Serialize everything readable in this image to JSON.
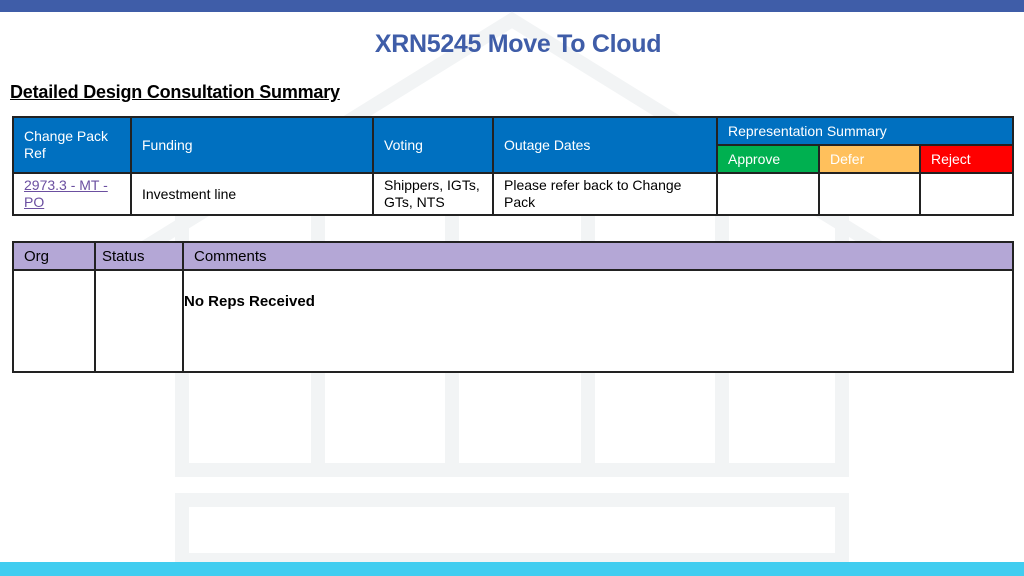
{
  "header": {
    "title": "XRN5245 Move To Cloud"
  },
  "section": {
    "subtitle": "Detailed Design Consultation Summary"
  },
  "summary_table": {
    "columns": [
      "Change Pack Ref",
      "Funding",
      "Voting",
      "Outage Dates",
      "Representation Summary"
    ],
    "representation_subcolumns": [
      "Approve",
      "Defer",
      "Reject"
    ],
    "representation_colors": {
      "approve": "#00b050",
      "defer": "#ffc05c",
      "reject": "#ff0000"
    },
    "rows": [
      {
        "change_pack_ref": "2973.3 - MT - PO",
        "funding": "Investment line",
        "voting": "Shippers, IGTs, GTs, NTS",
        "outage_dates": "Please refer back to Change Pack",
        "approve": "",
        "defer": "",
        "reject": ""
      }
    ]
  },
  "reps_table": {
    "columns": [
      "Org",
      "Status",
      "Comments"
    ],
    "rows": [
      {
        "org": "",
        "status": "",
        "comments": "No Reps Received"
      }
    ]
  },
  "colors": {
    "title": "#3f5da8",
    "header_blue": "#0070c0",
    "reps_header": "#b4a7d6",
    "top_bar": "#3f5da8",
    "bottom_bar": "#41cdf0"
  }
}
